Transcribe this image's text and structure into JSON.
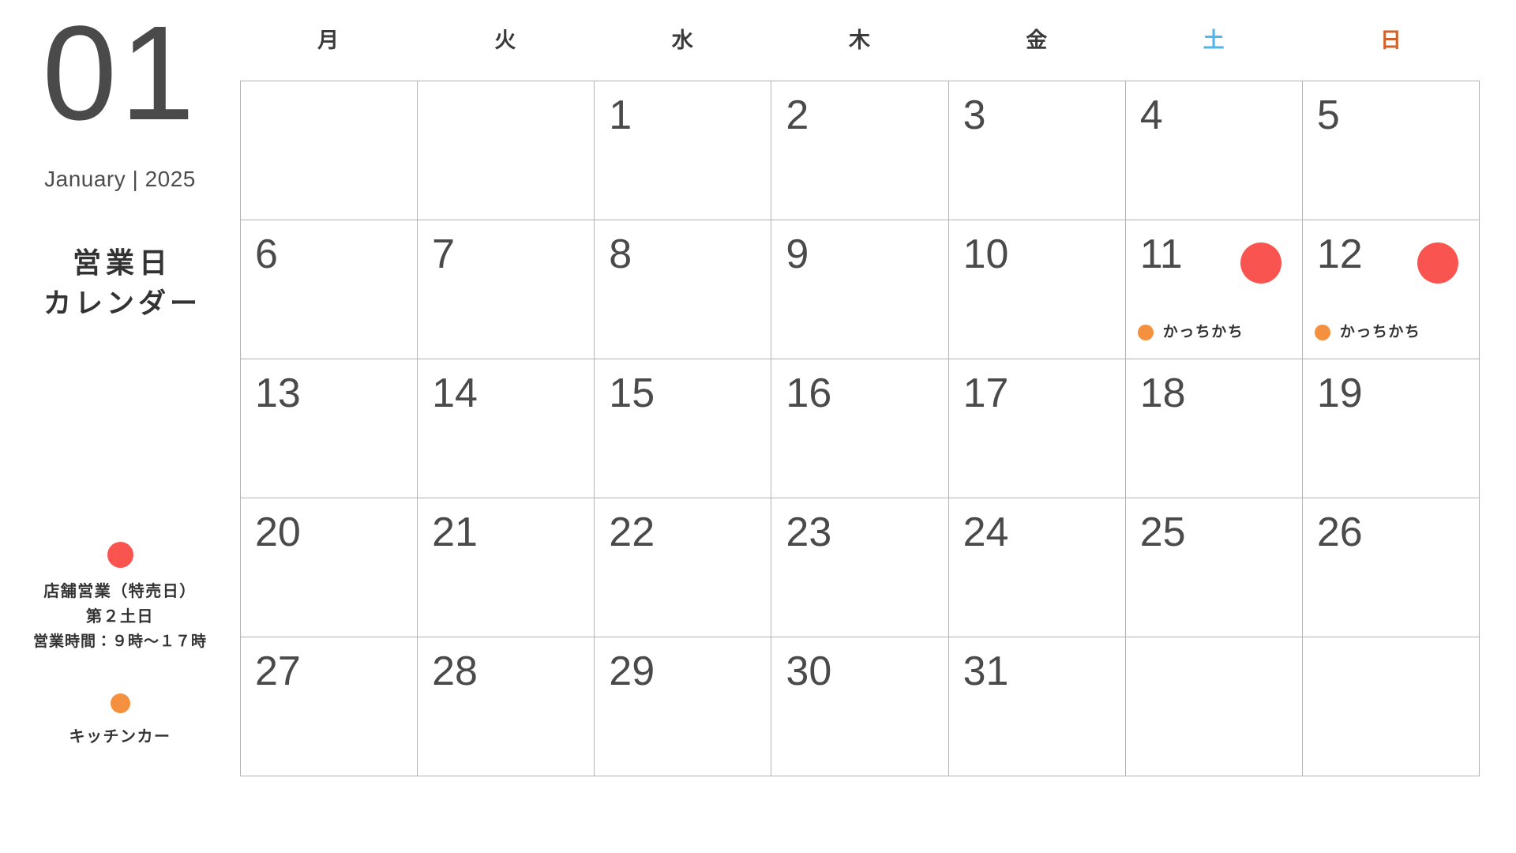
{
  "colors": {
    "red": "#f9544f",
    "orange": "#f5903e",
    "saturday": "#52b4ea",
    "sunday": "#d2622a",
    "text": "#4a4a4a",
    "grid_line": "#b3b3b3",
    "background": "#ffffff"
  },
  "sidebar": {
    "month_number": "01",
    "month_sub": "January | 2025",
    "title_line_1": "営業日",
    "title_line_2": "カレンダー",
    "legend": [
      {
        "id": "store-open",
        "dot_color": "#f9544f",
        "dot_icon": "red-circle-icon",
        "lines": [
          "店舗営業（特売日）",
          "第２土日",
          "営業時間：９時〜１７時"
        ]
      },
      {
        "id": "kitchen-car",
        "dot_color": "#f5903e",
        "dot_icon": "orange-circle-icon",
        "lines": [
          "キッチンカー"
        ]
      }
    ]
  },
  "calendar": {
    "weekdays": [
      {
        "label": "月",
        "kind": "weekday"
      },
      {
        "label": "火",
        "kind": "weekday"
      },
      {
        "label": "水",
        "kind": "weekday"
      },
      {
        "label": "木",
        "kind": "weekday"
      },
      {
        "label": "金",
        "kind": "weekday"
      },
      {
        "label": "土",
        "kind": "saturday"
      },
      {
        "label": "日",
        "kind": "sunday"
      }
    ],
    "weeks": [
      [
        {
          "day": ""
        },
        {
          "day": ""
        },
        {
          "day": "1"
        },
        {
          "day": "2"
        },
        {
          "day": "3"
        },
        {
          "day": "4"
        },
        {
          "day": "5"
        }
      ],
      [
        {
          "day": "6"
        },
        {
          "day": "7"
        },
        {
          "day": "8"
        },
        {
          "day": "9"
        },
        {
          "day": "10"
        },
        {
          "day": "11",
          "badge": "red",
          "event": {
            "dot": "orange",
            "label": "かっちかち"
          }
        },
        {
          "day": "12",
          "badge": "red",
          "event": {
            "dot": "orange",
            "label": "かっちかち"
          }
        }
      ],
      [
        {
          "day": "13"
        },
        {
          "day": "14"
        },
        {
          "day": "15"
        },
        {
          "day": "16"
        },
        {
          "day": "17"
        },
        {
          "day": "18"
        },
        {
          "day": "19"
        }
      ],
      [
        {
          "day": "20"
        },
        {
          "day": "21"
        },
        {
          "day": "22"
        },
        {
          "day": "23"
        },
        {
          "day": "24"
        },
        {
          "day": "25"
        },
        {
          "day": "26"
        }
      ],
      [
        {
          "day": "27"
        },
        {
          "day": "28"
        },
        {
          "day": "29"
        },
        {
          "day": "30"
        },
        {
          "day": "31"
        },
        {
          "day": ""
        },
        {
          "day": ""
        }
      ]
    ]
  }
}
